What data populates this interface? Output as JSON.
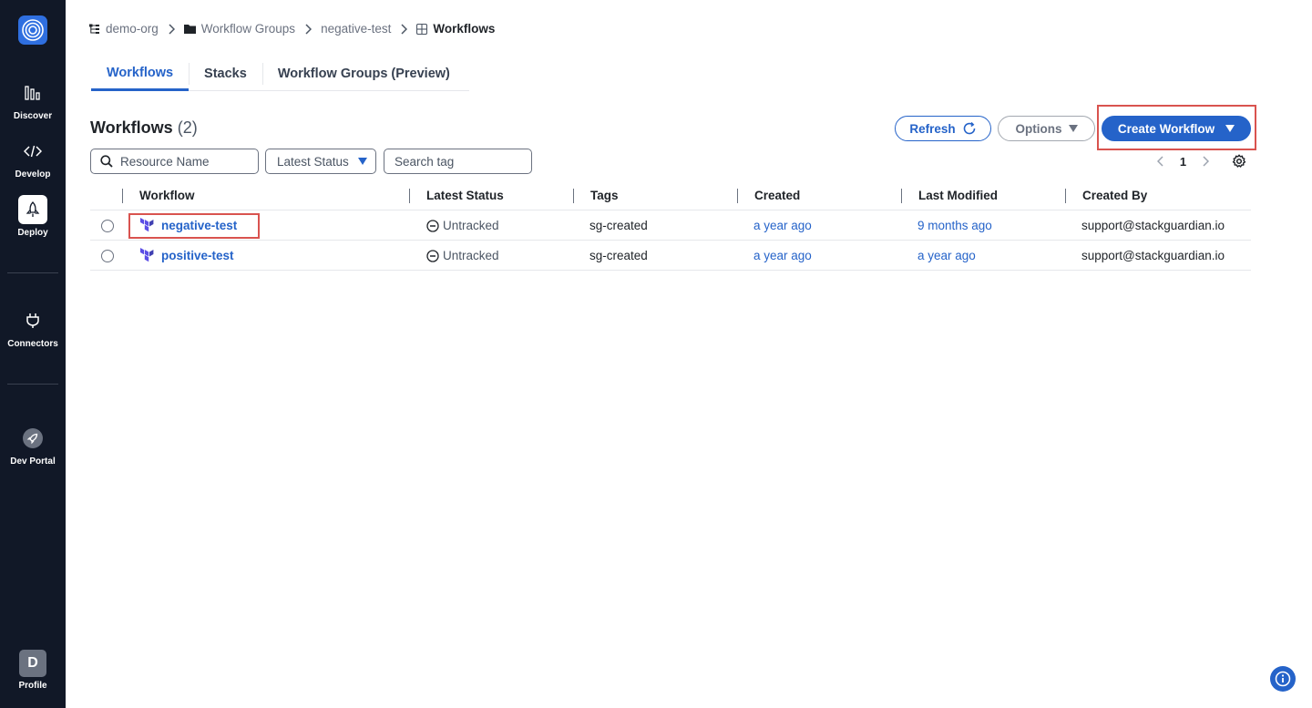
{
  "sidebar": {
    "logo_icon": "concentric-circles-icon",
    "items": [
      {
        "label": "Discover",
        "icon": "bar-chart-icon"
      },
      {
        "label": "Develop",
        "icon": "code-icon"
      },
      {
        "label": "Deploy",
        "icon": "rocket-icon",
        "active": true
      },
      {
        "label": "Connectors",
        "icon": "plug-icon"
      },
      {
        "label": "Dev Portal",
        "icon": "portal-rocket-icon"
      }
    ],
    "profile": {
      "initial": "D",
      "label": "Profile"
    }
  },
  "breadcrumb": [
    {
      "label": "demo-org",
      "icon": "org-tree-icon"
    },
    {
      "label": "Workflow Groups",
      "icon": "folder-icon"
    },
    {
      "label": "negative-test"
    },
    {
      "label": "Workflows",
      "icon": "grid-icon",
      "current": true
    }
  ],
  "tabs": [
    {
      "label": "Workflows",
      "active": true
    },
    {
      "label": "Stacks"
    },
    {
      "label": "Workflow Groups (Preview)"
    }
  ],
  "header": {
    "title": "Workflows",
    "count": "(2)",
    "refresh_label": "Refresh",
    "options_label": "Options",
    "create_label": "Create Workflow"
  },
  "filters": {
    "resource_name_placeholder": "Resource Name",
    "latest_status_label": "Latest Status",
    "search_tag_placeholder": "Search tag"
  },
  "pagination": {
    "current_page": "1"
  },
  "table": {
    "columns": [
      "Workflow",
      "Latest Status",
      "Tags",
      "Created",
      "Last Modified",
      "Created By"
    ],
    "rows": [
      {
        "workflow": "negative-test",
        "status": "Untracked",
        "tags": "sg-created",
        "created": "a year ago",
        "last_modified": "9 months ago",
        "created_by": "support@stackguardian.io"
      },
      {
        "workflow": "positive-test",
        "status": "Untracked",
        "tags": "sg-created",
        "created": "a year ago",
        "last_modified": "a year ago",
        "created_by": "support@stackguardian.io"
      }
    ]
  },
  "colors": {
    "sidebar_bg": "#111827",
    "accent": "#2563c9",
    "highlight": "#d9534f",
    "terraform_purple": "#5c4ee5"
  }
}
